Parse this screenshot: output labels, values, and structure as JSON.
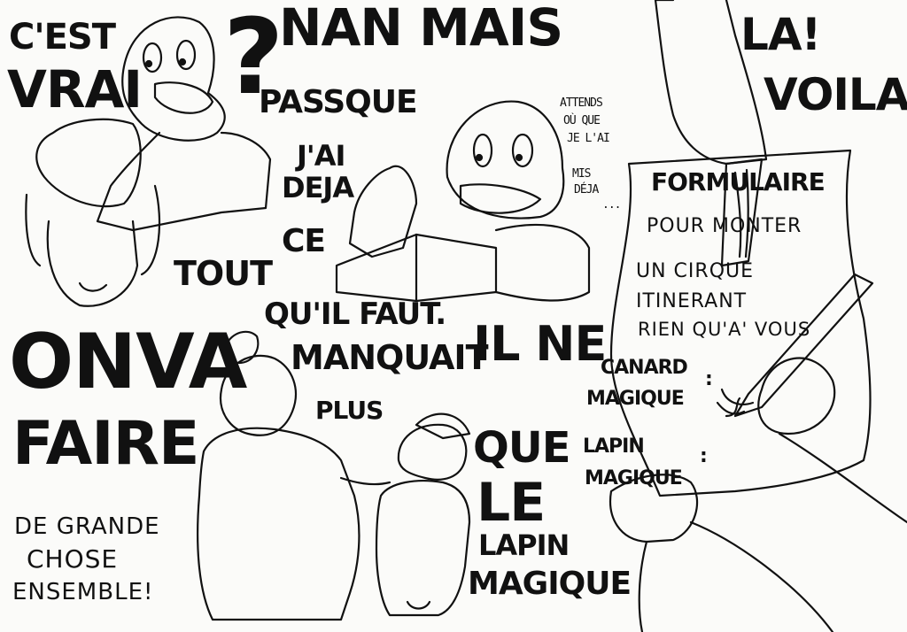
{
  "panel_top_left": {
    "cest": "C'EST",
    "vrai": "VRAI",
    "question": "?",
    "nan_mais": "NAN MAIS",
    "passque": "PASSQUE",
    "jai": "J'AI",
    "deja": "DEJA",
    "tout": "TOUT",
    "ce": "CE",
    "quil_faut": "QU'IL FAUT."
  },
  "panel_top_mid": {
    "attends": "ATTENDS",
    "ou_que": "OÙ QUE",
    "jelai": "JE L'AI",
    "mis": "MIS",
    "deja": "DÉJA",
    "dots": "..."
  },
  "panel_top_right": {
    "la": "LA!",
    "voila": "VOILA!",
    "form_title": "FORMULAIRE",
    "form_line2": "POUR MONTER",
    "form_line3": "UN CIRQUE",
    "form_line4": "ITINERANT",
    "form_line5": "RIEN QU'A' VOUS",
    "field1_a": "CANARD",
    "field1_b": "MAGIQUE",
    "field1_colon": ":",
    "field2_a": "LAPIN",
    "field2_b": "MAGIQUE",
    "field2_colon": ":"
  },
  "panel_bottom": {
    "on_va": "ONVA",
    "faire": "FAIRE",
    "de_grande": "DE GRANDE",
    "chose": "CHOSE",
    "ensemble": "ENSEMBLE!",
    "il_ne": "IL NE",
    "manquait": "MANQUAIT",
    "plus": "PLUS",
    "que": "QUE",
    "le": "LE",
    "lapin": "LAPIN",
    "magique": "MAGIQUE"
  },
  "colors": {
    "ink": "#111111",
    "paper": "#fbfbf9"
  }
}
